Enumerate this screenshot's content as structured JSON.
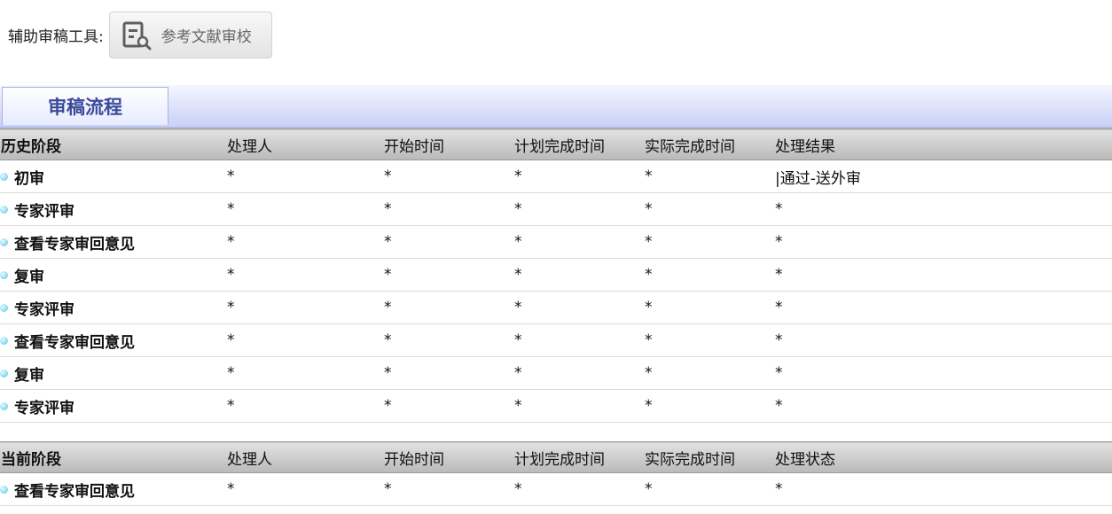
{
  "toolbar": {
    "label": "辅助审稿工具:",
    "tool_button": "参考文献审校",
    "tool_icon": "document-search-icon"
  },
  "tab": {
    "label": "审稿流程"
  },
  "history": {
    "headers": [
      "历史阶段",
      "处理人",
      "开始时间",
      "计划完成时间",
      "实际完成时间",
      "处理结果"
    ],
    "rows": [
      {
        "stage": "初审",
        "handler": "*",
        "start": "*",
        "planned": "*",
        "actual": "*",
        "result": "|通过-送外审"
      },
      {
        "stage": "专家评审",
        "handler": "*",
        "start": "*",
        "planned": "*",
        "actual": "*",
        "result": "*"
      },
      {
        "stage": "查看专家审回意见",
        "handler": "*",
        "start": "*",
        "planned": "*",
        "actual": "*",
        "result": "*"
      },
      {
        "stage": "复审",
        "handler": "*",
        "start": "*",
        "planned": "*",
        "actual": "*",
        "result": "*"
      },
      {
        "stage": "专家评审",
        "handler": "*",
        "start": "*",
        "planned": "*",
        "actual": "*",
        "result": "*"
      },
      {
        "stage": "查看专家审回意见",
        "handler": "*",
        "start": "*",
        "planned": "*",
        "actual": "*",
        "result": "*"
      },
      {
        "stage": "复审",
        "handler": "*",
        "start": "*",
        "planned": "*",
        "actual": "*",
        "result": "*"
      },
      {
        "stage": "专家评审",
        "handler": "*",
        "start": "*",
        "planned": "*",
        "actual": "*",
        "result": "*"
      }
    ]
  },
  "current": {
    "headers": [
      "当前阶段",
      "处理人",
      "开始时间",
      "计划完成时间",
      "实际完成时间",
      "处理状态"
    ],
    "rows": [
      {
        "stage": "查看专家审回意见",
        "handler": "*",
        "start": "*",
        "planned": "*",
        "actual": "*",
        "result": "*"
      }
    ]
  }
}
